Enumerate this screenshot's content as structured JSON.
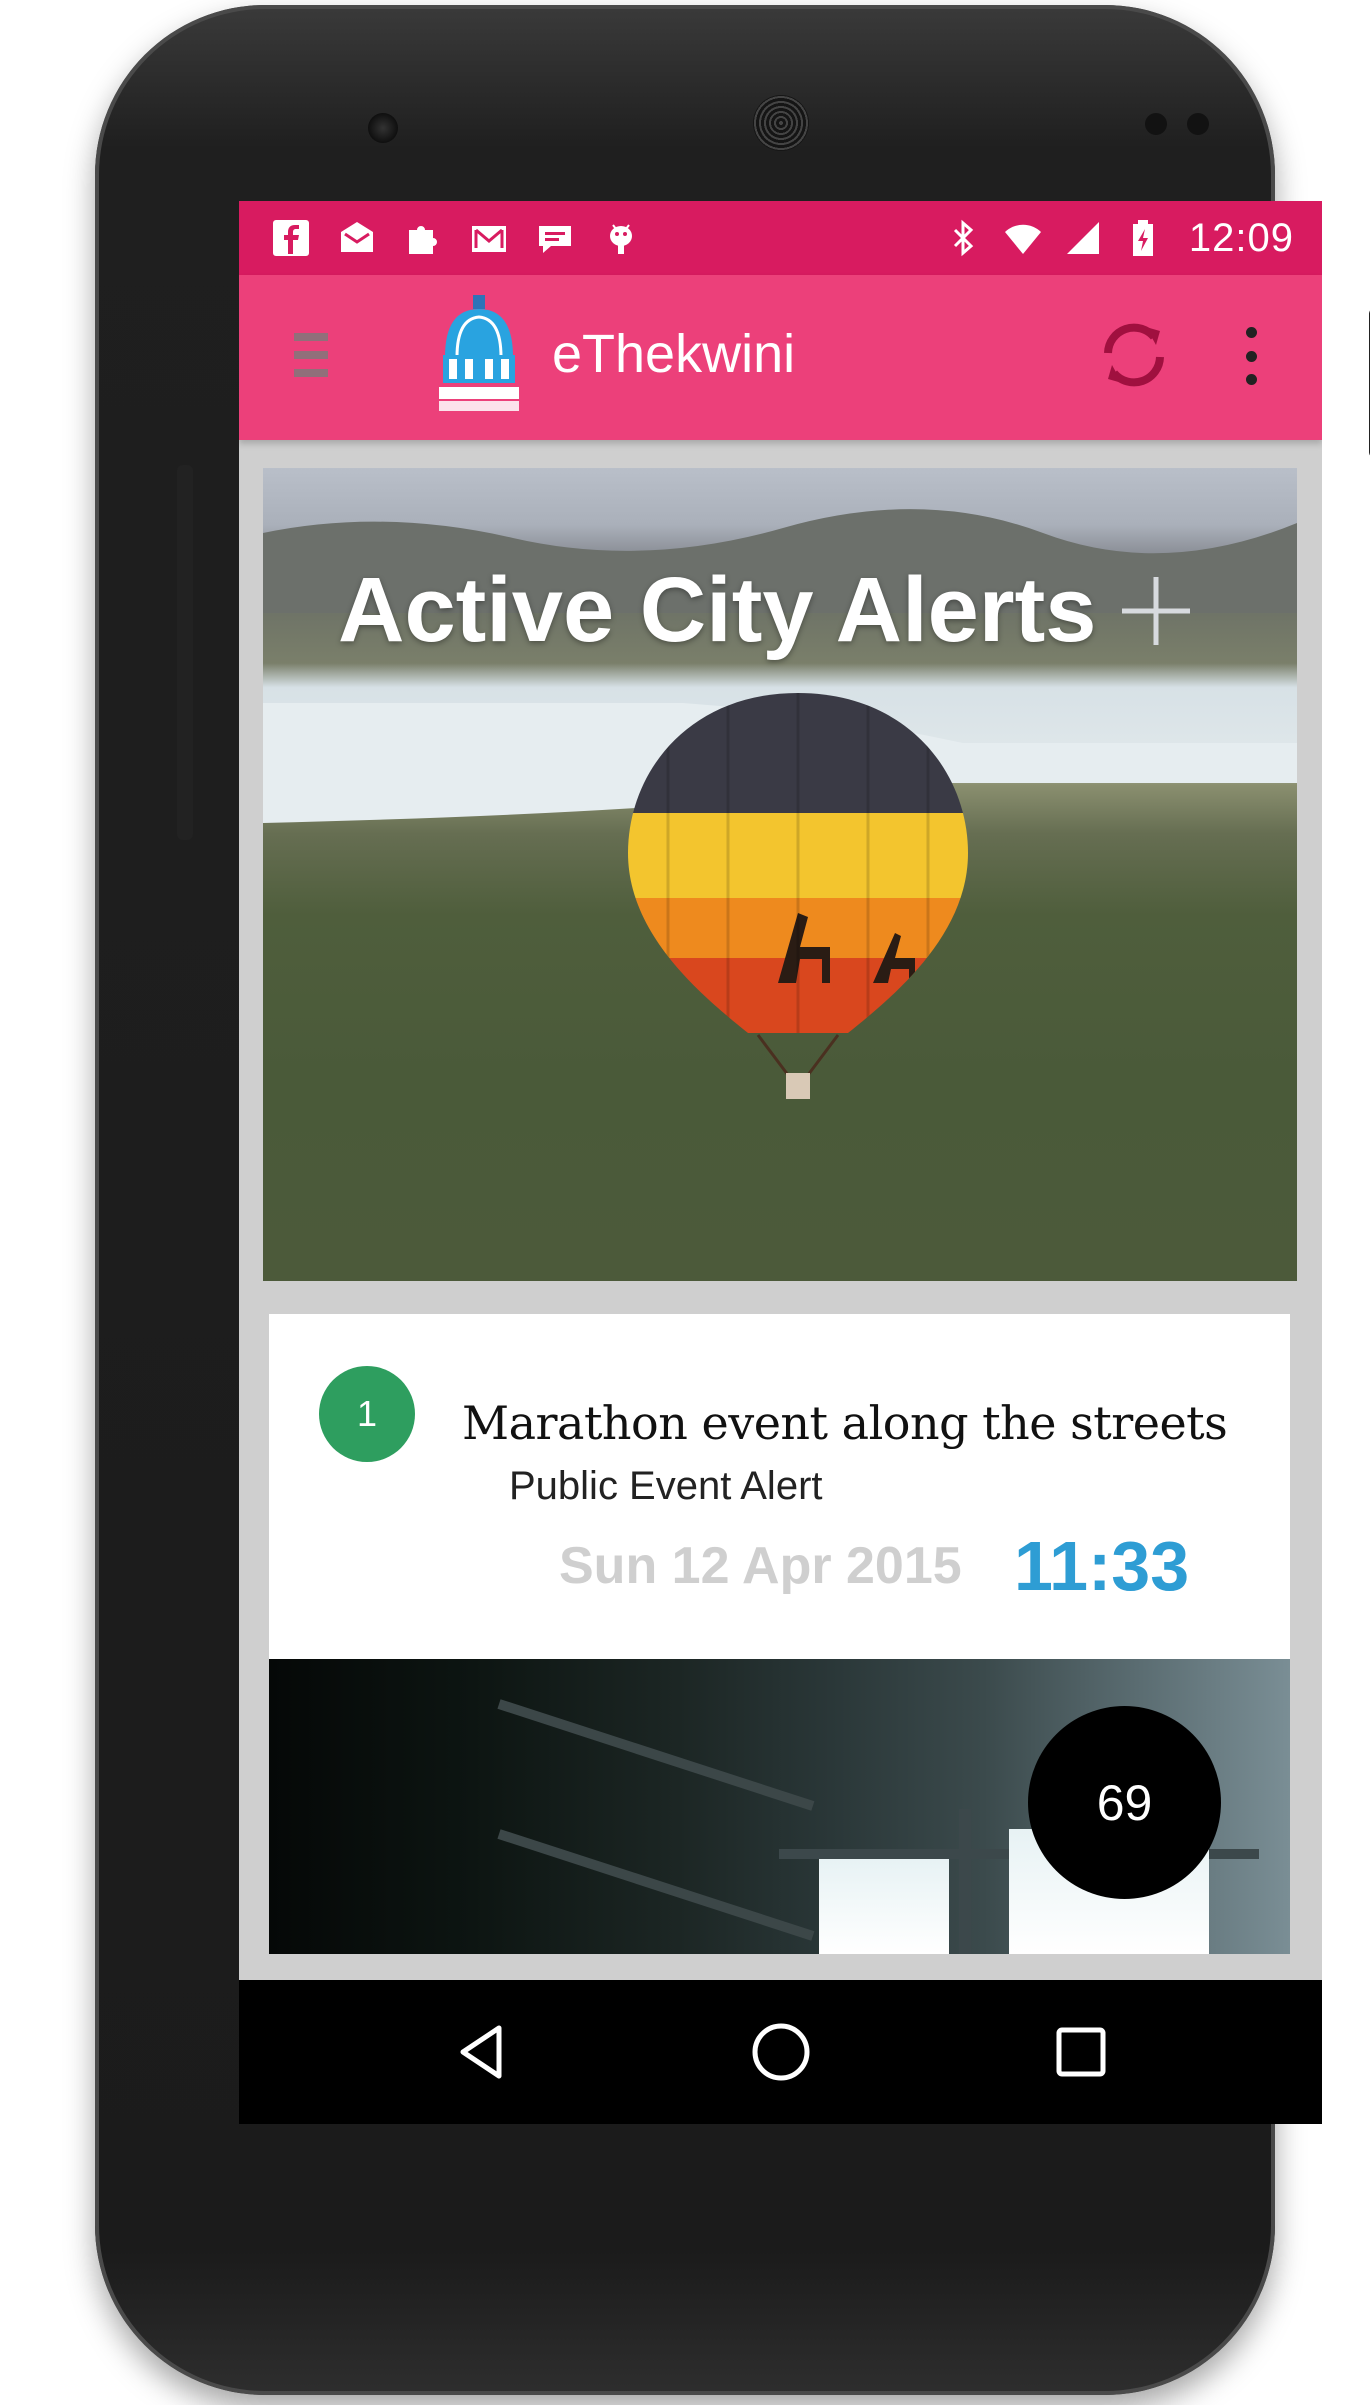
{
  "status_bar": {
    "time": "12:09",
    "icons_left": [
      "facebook-icon",
      "email-icon",
      "puzzle-icon",
      "gmail-icon",
      "chat-icon",
      "android-icon"
    ],
    "icons_right": [
      "bluetooth-icon",
      "wifi-icon",
      "cell-signal-icon",
      "battery-charging-icon"
    ]
  },
  "app_bar": {
    "title": "eThekwini",
    "logo": "ethekwini-municipality-logo"
  },
  "hero": {
    "title": "Active City Alerts"
  },
  "alerts": [
    {
      "number": "1",
      "title": "Marathon event along the streets",
      "type": "Public Event Alert",
      "date": "Sun 12 Apr 2015",
      "time": "11:33"
    }
  ],
  "fab": {
    "label": "69"
  },
  "colors": {
    "status_bar": "#d81b60",
    "app_bar": "#ec407a",
    "badge": "#2e9e5f",
    "time_accent": "#2e9dd4"
  }
}
